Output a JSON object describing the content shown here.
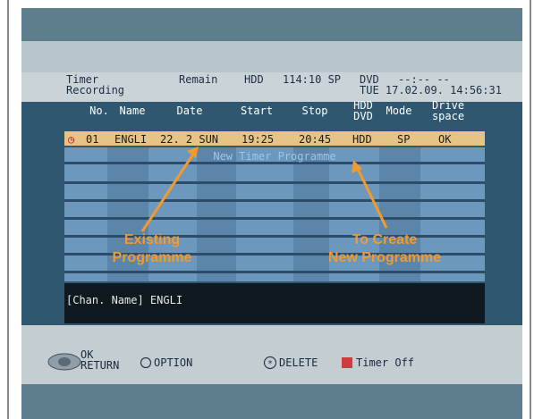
{
  "header": {
    "title_line1": "Timer",
    "title_line2": "Recording",
    "remain_label": "Remain",
    "hdd_label": "HDD",
    "hdd_remain": "114:10 SP",
    "dvd_label": "DVD",
    "dvd_remain": "--:-- --",
    "datetime": "TUE 17.02.09. 14:56:31"
  },
  "columns": {
    "no": "No.",
    "name": "Name",
    "date": "Date",
    "start": "Start",
    "stop": "Stop",
    "media_line1": "HDD",
    "media_line2": "DVD",
    "mode": "Mode",
    "drive_line1": "Drive",
    "drive_line2": "space"
  },
  "programme": {
    "no": "01",
    "name": "ENGLI",
    "date": "22. 2 SUN",
    "start": "19:25",
    "stop": "20:45",
    "media": "HDD",
    "mode": "SP",
    "drive_space": "OK"
  },
  "new_timer_label": "New Timer Programme",
  "channel_info": "[Chan. Name] ENGLI",
  "footer": {
    "ok": "OK",
    "return": "RETURN",
    "option": "OPTION",
    "delete": "DELETE",
    "timer_off": "Timer Off"
  },
  "callouts": {
    "existing_line1": "Existing",
    "existing_line2": "Programme",
    "create_line1": "To Create",
    "create_line2": "New Programme"
  },
  "colors": {
    "accent": "#f39a2e",
    "row_highlight": "#e7c385",
    "timer_off_red": "#d23b3b"
  }
}
